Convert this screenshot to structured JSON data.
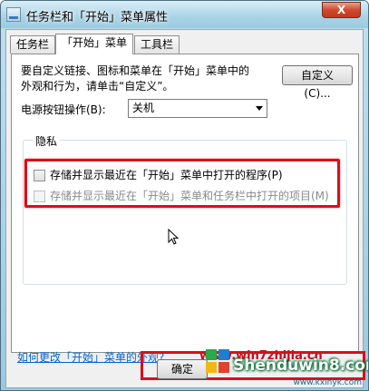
{
  "window": {
    "title": "任务栏和「开始」菜单属性",
    "close_label": "X"
  },
  "tabs": [
    {
      "label": "任务栏",
      "active": false
    },
    {
      "label": "「开始」菜单",
      "active": true
    },
    {
      "label": "工具栏",
      "active": false
    }
  ],
  "start_menu": {
    "description_line1": "要自定义链接、图标和菜单在「开始」菜单中的",
    "description_line2": "外观和行为，请单击“自定义”。",
    "customize_button": "自定义(C)...",
    "power_label": "电源按钮操作(B):",
    "power_value": "关机",
    "privacy_title": "隐私",
    "privacy_options": [
      {
        "label": "存储并显示最近在「开始」菜单中打开的程序(P)",
        "checked": false,
        "enabled": true
      },
      {
        "label": "存储并显示最近在「开始」菜单和任务栏中打开的项目(M)",
        "checked": false,
        "enabled": false
      }
    ],
    "help_link": "如何更改「开始」菜单的外观?"
  },
  "buttons": {
    "ok": "确定"
  },
  "watermark": {
    "url": "www.win7zhijia.cn",
    "logo_text": "Shenduwin8.com",
    "logo_sub": "www.kxinyk.com"
  },
  "colors": {
    "highlight_red": "#d8101c",
    "link_blue": "#0066cc"
  }
}
